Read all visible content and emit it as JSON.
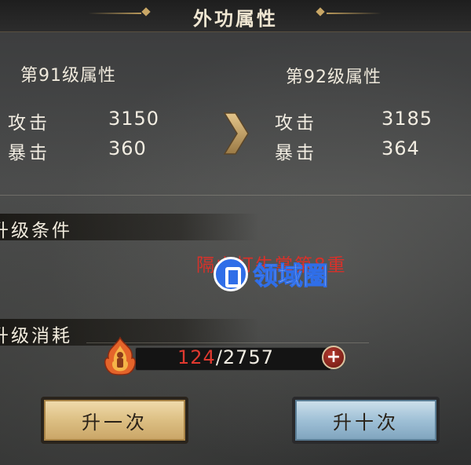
{
  "header": {
    "title": "外功属性"
  },
  "current": {
    "level_label": "第91级属性",
    "stats": [
      {
        "name": "攻击",
        "value": "3150"
      },
      {
        "name": "暴击",
        "value": "360"
      }
    ]
  },
  "next": {
    "level_label": "第92级属性",
    "stats": [
      {
        "name": "攻击",
        "value": "3185"
      },
      {
        "name": "暴击",
        "value": "364"
      }
    ]
  },
  "conditions": {
    "title": "升级条件",
    "requirement_text": "隔山打牛掌第8重"
  },
  "cost": {
    "title": "升级消耗",
    "current": "124",
    "separator": "/",
    "required": "2757",
    "plus_label": "+",
    "icon": "flame-figure-icon"
  },
  "buttons": {
    "upgrade_once": "升一次",
    "upgrade_ten": "升十次"
  },
  "watermark": {
    "text": "领域圈"
  },
  "colors": {
    "requirement_red": "#d8312a",
    "cost_current_red": "#e0392f",
    "button_gold": "#dcbf83",
    "button_blue": "#9fc0d6",
    "watermark_blue": "#2f6ee8"
  }
}
